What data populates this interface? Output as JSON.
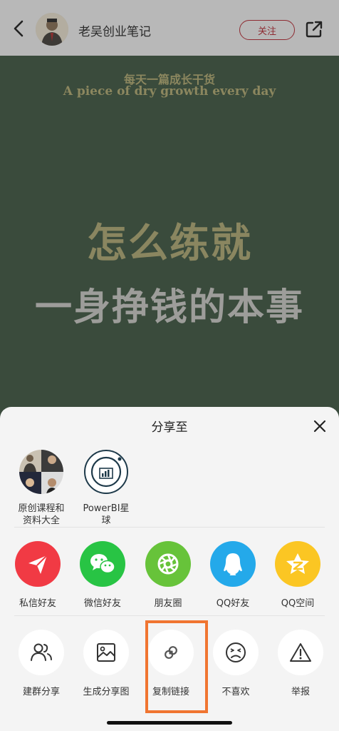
{
  "topbar": {
    "author": "老吴创业笔记",
    "follow_label": "关注",
    "icons": [
      "back-arrow-icon",
      "share-external-icon"
    ]
  },
  "hero": {
    "subtitle_cn": "每天一篇成长干货",
    "subtitle_en": "A piece of dry growth every day",
    "headline_1": "怎么练就",
    "headline_2": "一身挣钱的本事"
  },
  "sheet": {
    "title": "分享至",
    "contacts": [
      {
        "label_line1": "原创课程和",
        "label_line2": "资料大全"
      },
      {
        "label_line1": "PowerBI星",
        "label_line2": "球"
      }
    ],
    "apps": [
      {
        "label": "私信好友",
        "icon": "send-icon",
        "color": "#f13a44"
      },
      {
        "label": "微信好友",
        "icon": "wechat-icon",
        "color": "#28c444"
      },
      {
        "label": "朋友圈",
        "icon": "moments-icon",
        "color": "#67c33a"
      },
      {
        "label": "QQ好友",
        "icon": "qq-icon",
        "color": "#24a9ea"
      },
      {
        "label": "QQ空间",
        "icon": "qzone-icon",
        "color": "#fbc623"
      }
    ],
    "actions": [
      {
        "label": "建群分享",
        "icon": "group-icon"
      },
      {
        "label": "生成分享图",
        "icon": "image-icon"
      },
      {
        "label": "复制链接",
        "icon": "link-icon"
      },
      {
        "label": "不喜欢",
        "icon": "dislike-icon"
      },
      {
        "label": "举报",
        "icon": "warning-icon"
      }
    ],
    "highlight_color": "#f07531"
  }
}
